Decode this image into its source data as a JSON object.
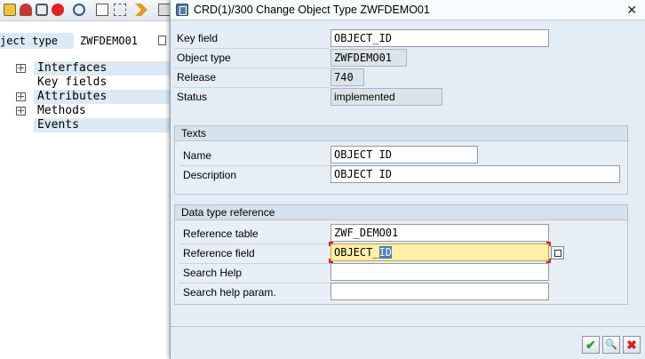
{
  "bg": {
    "toolbar_icons": [
      "sap-toolbar-icon-1",
      "sap-toolbar-icon-2",
      "sap-toolbar-icon-3",
      "sap-toolbar-icon-4",
      "sap-toolbar-icon-5",
      "sap-toolbar-icon-6",
      "sap-toolbar-icon-7",
      "sap-toolbar-icon-8",
      "sap-toolbar-icon-9"
    ],
    "object_type_label": "ject type",
    "object_type_value": "ZWFDEMO01",
    "tree": [
      {
        "label": "Interfaces",
        "expandable": true
      },
      {
        "label": "Key fields",
        "expandable": false
      },
      {
        "label": "Attributes",
        "expandable": true
      },
      {
        "label": "Methods",
        "expandable": true
      },
      {
        "label": "Events",
        "expandable": false
      }
    ]
  },
  "dialog": {
    "title": "CRD(1)/300 Change Object Type ZWFDEMO01",
    "close_glyph": "✕",
    "header_fields": {
      "key_field": {
        "label": "Key field",
        "value": "OBJECT_ID"
      },
      "object_type": {
        "label": "Object type",
        "value": "ZWFDEMO01"
      },
      "release": {
        "label": "Release",
        "value": "740"
      },
      "status": {
        "label": "Status",
        "value": "implemented"
      }
    },
    "texts_group": {
      "title": "Texts",
      "name": {
        "label": "Name",
        "value": "OBJECT ID"
      },
      "description": {
        "label": "Description",
        "value": "OBJECT ID"
      }
    },
    "dtref_group": {
      "title": "Data type reference",
      "reference_table": {
        "label": "Reference table",
        "value": "ZWF_DEMO01"
      },
      "reference_field": {
        "label": "Reference field",
        "value_prefix": "OBJECT_",
        "value_selected": "ID"
      },
      "search_help": {
        "label": "Search Help",
        "value": ""
      },
      "search_help_param": {
        "label": "Search help param.",
        "value": ""
      }
    },
    "footer": {
      "ok_glyph": "✔",
      "check_glyph": "🔍",
      "cancel_glyph": "✖"
    }
  },
  "colors": {
    "accent_highlight": "#ffefa8",
    "selection": "#4a7db8",
    "ok_green": "#2e9a2e",
    "cancel_red": "#d22020"
  }
}
